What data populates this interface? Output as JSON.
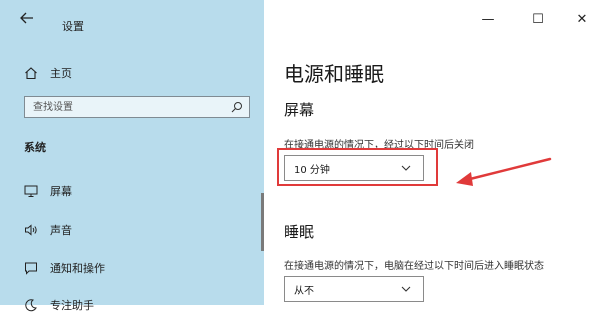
{
  "window": {
    "title": "设置",
    "controls": {
      "minimize": "—",
      "maximize": "☐",
      "close": "✕"
    }
  },
  "nav": {
    "home_label": "主页",
    "search_placeholder": "查找设置",
    "section": "系统",
    "items": [
      {
        "label": "屏幕",
        "icon": "monitor-icon"
      },
      {
        "label": "声音",
        "icon": "speaker-icon"
      },
      {
        "label": "通知和操作",
        "icon": "notification-icon"
      },
      {
        "label": "专注助手",
        "icon": "moon-icon"
      }
    ]
  },
  "main": {
    "title": "电源和睡眠",
    "screen": {
      "heading": "屏幕",
      "description": "在接通电源的情况下，经过以下时间后关闭",
      "value": "10 分钟"
    },
    "sleep": {
      "heading": "睡眠",
      "description": "在接通电源的情况下，电脑在经过以下时间后进入睡眠状态",
      "value": "从不"
    }
  },
  "colors": {
    "nav_background": "#b8dcec",
    "annotation_red": "#e03a3a"
  }
}
